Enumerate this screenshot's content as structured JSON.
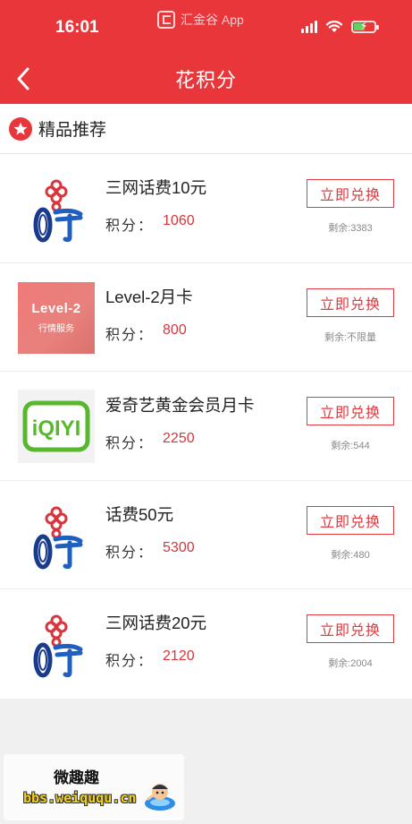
{
  "status_bar": {
    "time": "16:01",
    "app_indicator": "汇金谷 App"
  },
  "nav": {
    "title": "花积分"
  },
  "section": {
    "title": "精品推荐"
  },
  "items": [
    {
      "name": "三网话费10元",
      "points_label": "积分：",
      "points": "1060",
      "button": "立即兑换",
      "remain": "剩余:3383",
      "thumb": "china-unicom-logo"
    },
    {
      "name": "Level-2月卡",
      "points_label": "积分：",
      "points": "800",
      "button": "立即兑换",
      "remain": "剩余:不限量",
      "thumb": "level2-card",
      "thumb_title": "Level-2",
      "thumb_sub": "行情服务"
    },
    {
      "name": "爱奇艺黄金会员月卡",
      "points_label": "积分：",
      "points": "2250",
      "button": "立即兑换",
      "remain": "剩余:544",
      "thumb": "iqiyi-logo"
    },
    {
      "name": "话费50元",
      "points_label": "积分：",
      "points": "5300",
      "button": "立即兑换",
      "remain": "剩余:480",
      "thumb": "china-unicom-logo"
    },
    {
      "name": "三网话费20元",
      "points_label": "积分：",
      "points": "2120",
      "button": "立即兑换",
      "remain": "剩余:2004",
      "thumb": "china-unicom-logo"
    }
  ],
  "watermark": {
    "title": "微趣趣",
    "url": "bbs.weiququ.cn"
  },
  "colors": {
    "brand_red": "#e8363a",
    "points_red": "#d9363c",
    "page_bg": "#f0f0f0"
  }
}
